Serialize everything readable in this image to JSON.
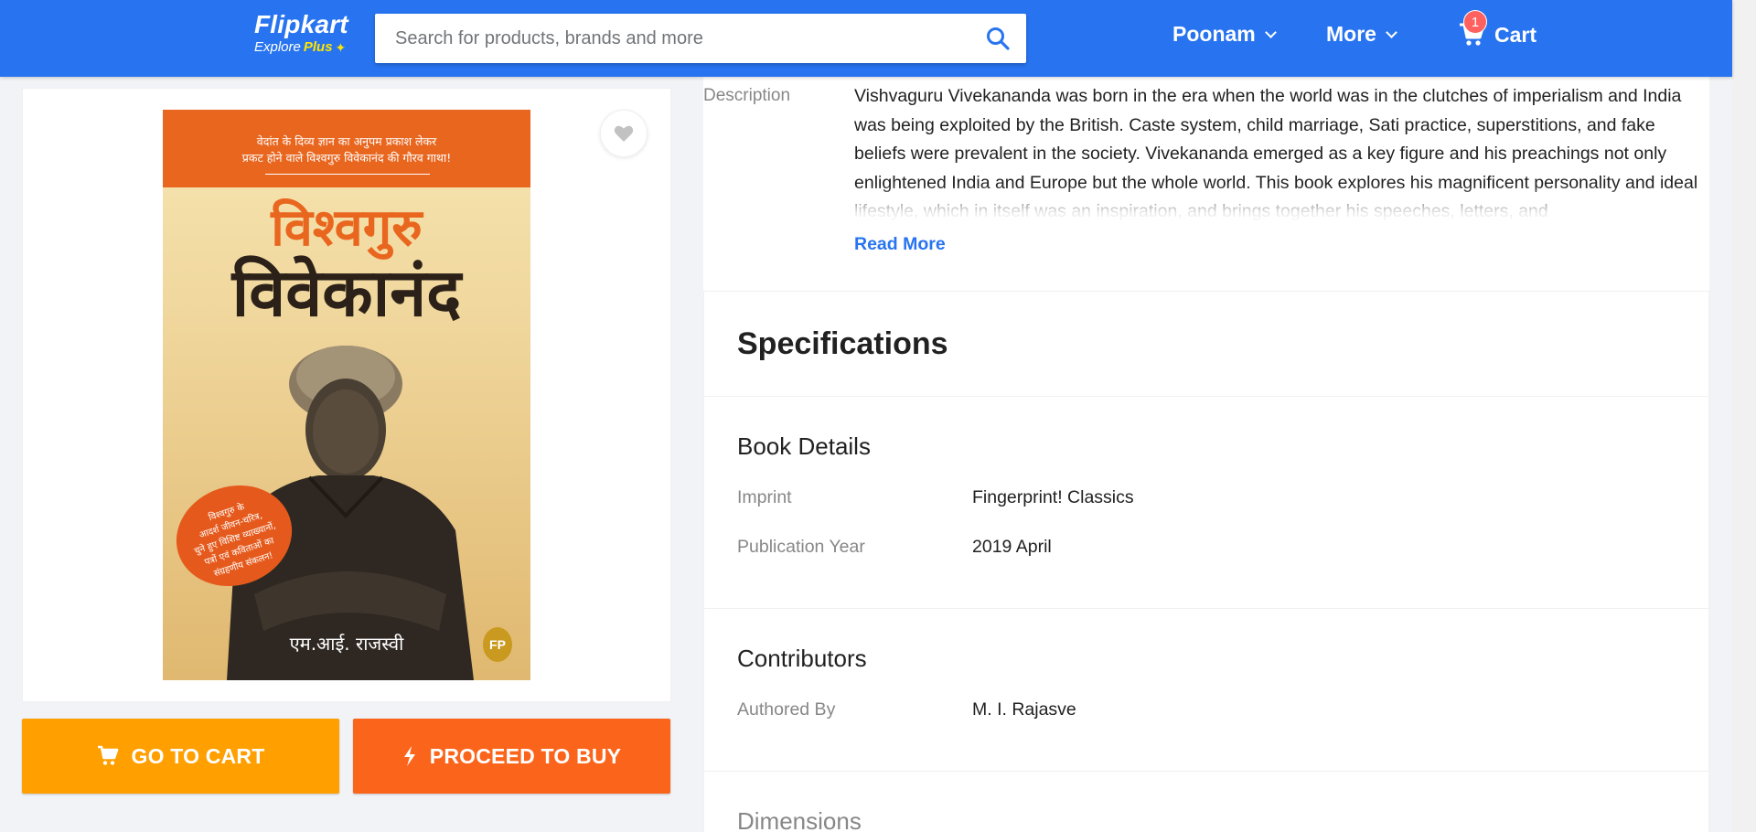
{
  "header": {
    "logo_name": "Flipkart",
    "logo_explore": "Explore",
    "logo_plus": "Plus",
    "search_placeholder": "Search for products, brands and more",
    "user_label": "Poonam",
    "more_label": "More",
    "cart_label": "Cart",
    "cart_count": "1",
    "bg_color": "#2874f0"
  },
  "product_image": {
    "cover_tagline_1": "वेदांत के दिव्य ज्ञान का अनुपम प्रकाश लेकर",
    "cover_tagline_2": "प्रकट होने वाले विश्वगुरु विवेकानंद की गौरव गाथा!",
    "cover_title_1": "विश्वगुरु",
    "cover_title_2": "विवेकानंद",
    "cover_seal_1": "विश्वगुरु के",
    "cover_seal_2": "आदर्श जीवन-चरित्र,",
    "cover_seal_3": "चुने हुए विशिष्ट व्याख्यानों,",
    "cover_seal_4": "पत्रों एवं कविताओं का",
    "cover_seal_5": "संग्रहणीय संकलन!",
    "cover_author": "एम.आई. राजस्वी",
    "publisher_badge": "FP",
    "wishlist_icon": "heart-icon"
  },
  "actions": {
    "go_to_cart": "GO TO CART",
    "proceed_to_buy": "PROCEED TO BUY",
    "cart_color": "#ff9f00",
    "buy_color": "#fb641b"
  },
  "description": {
    "label": "Description",
    "text": "Vishvaguru Vivekananda was born in the era when the world was in the clutches of imperialism and India was being exploited by the British. Caste system, child marriage, Sati practice, superstitions, and fake beliefs were prevalent in the society. Vivekananda emerged as a key figure and his preachings not only enlightened India and Europe but the whole world. This book explores his magnificent personality and ideal lifestyle, which in itself was an inspiration, and brings together his speeches, letters, and",
    "read_more": "Read More"
  },
  "specifications": {
    "title": "Specifications",
    "book_details": {
      "heading": "Book Details",
      "rows": [
        {
          "key": "Imprint",
          "value": "Fingerprint! Classics"
        },
        {
          "key": "Publication Year",
          "value": "2019 April"
        }
      ]
    },
    "contributors": {
      "heading": "Contributors",
      "rows": [
        {
          "key": "Authored By",
          "value": "M. I. Rajasve"
        }
      ]
    },
    "dimensions": {
      "heading": "Dimensions"
    }
  }
}
